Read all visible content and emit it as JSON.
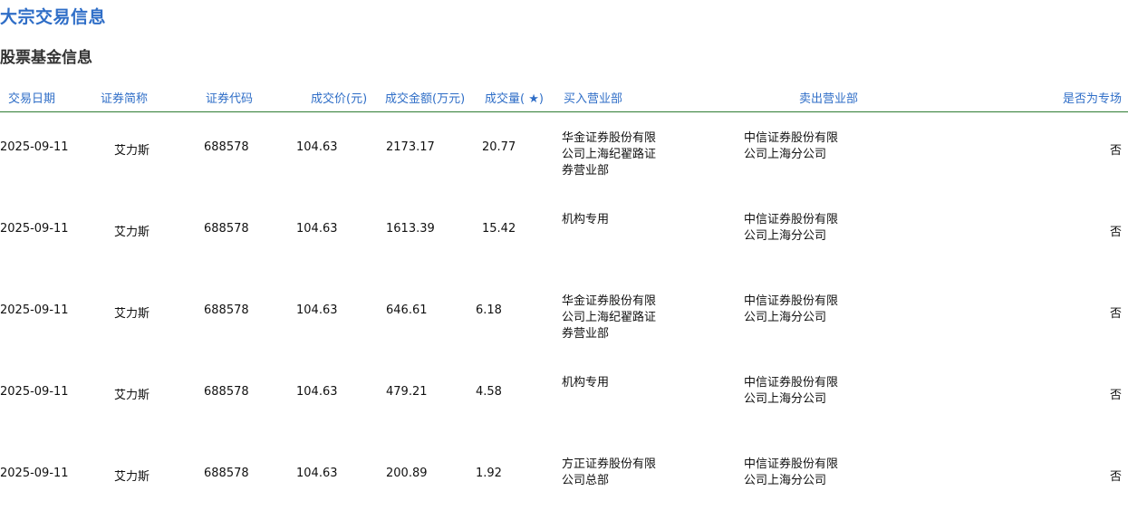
{
  "page": {
    "title": "大宗交易信息",
    "subtitle": "股票基金信息"
  },
  "table": {
    "headers": {
      "date": "交易日期",
      "name": "证券简称",
      "code": "证券代码",
      "price": "成交价(元)",
      "amount": "成交金额(万元)",
      "volume": "成交量( ★)",
      "buyer": "买入营业部",
      "seller": "卖出营业部",
      "special": "是否为专场"
    },
    "rows": [
      {
        "date": "2025-09-11",
        "name": "艾力斯",
        "code": "688578",
        "price": "104.63",
        "amount": "2173.17",
        "volume": "20.77",
        "buyer": "华金证券股份有限公司上海纪翟路证券营业部",
        "seller": "中信证券股份有限公司上海分公司",
        "special": "否"
      },
      {
        "date": "2025-09-11",
        "name": "艾力斯",
        "code": "688578",
        "price": "104.63",
        "amount": "1613.39",
        "volume": "15.42",
        "buyer": "机构专用",
        "seller": "中信证券股份有限公司上海分公司",
        "special": "否"
      },
      {
        "date": "2025-09-11",
        "name": "艾力斯",
        "code": "688578",
        "price": "104.63",
        "amount": "646.61",
        "volume": "6.18",
        "buyer": "华金证券股份有限公司上海纪翟路证券营业部",
        "seller": "中信证券股份有限公司上海分公司",
        "special": "否"
      },
      {
        "date": "2025-09-11",
        "name": "艾力斯",
        "code": "688578",
        "price": "104.63",
        "amount": "479.21",
        "volume": "4.58",
        "buyer": "机构专用",
        "seller": "中信证券股份有限公司上海分公司",
        "special": "否"
      },
      {
        "date": "2025-09-11",
        "name": "艾力斯",
        "code": "688578",
        "price": "104.63",
        "amount": "200.89",
        "volume": "1.92",
        "buyer": "方正证券股份有限公司总部",
        "seller": "中信证券股份有限公司上海分公司",
        "special": "否"
      }
    ]
  },
  "colors": {
    "accent": "#2f6ec7",
    "divider": "#2e7d32"
  }
}
